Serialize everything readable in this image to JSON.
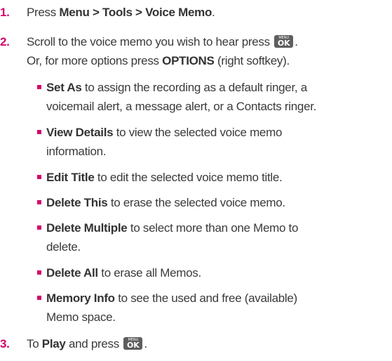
{
  "steps": [
    {
      "num": "1.",
      "pre": "Press ",
      "bold": "Menu > Tools > Voice Memo",
      "post": "."
    },
    {
      "num": "2.",
      "pre": "Scroll to the voice memo you wish to hear press ",
      "post": ".",
      "line2_pre": "Or, for more options press ",
      "line2_bold": "OPTIONS",
      "line2_post": " (right softkey)."
    },
    {
      "num": "3.",
      "pre": "To ",
      "bold": "Play",
      "post": " and press "
    }
  ],
  "options": [
    {
      "term": "Set As",
      "desc": " to assign the recording as a default ringer, a",
      "desc2": "voicemail alert, a message alert, or a Contacts ringer."
    },
    {
      "term": "View Details",
      "desc": " to view the selected voice memo",
      "desc2": "information."
    },
    {
      "term": "Edit Title",
      "desc": " to edit the selected voice memo title."
    },
    {
      "term": "Delete This",
      "desc": " to erase the selected voice memo."
    },
    {
      "term": "Delete Multiple",
      "desc": " to select more than one Memo to",
      "desc2": "delete."
    },
    {
      "term": "Delete All",
      "desc": " to erase all Memos."
    },
    {
      "term": "Memory Info",
      "desc": " to see the used and free (available)",
      "desc2": "Memo space."
    }
  ],
  "key": {
    "top": "MENU",
    "bottom": "OK",
    "icon": "menu-ok-key-icon"
  },
  "colors": {
    "accent": "#d4006a",
    "text": "#3a3a3a",
    "key_bg": "#5e5e5e"
  }
}
